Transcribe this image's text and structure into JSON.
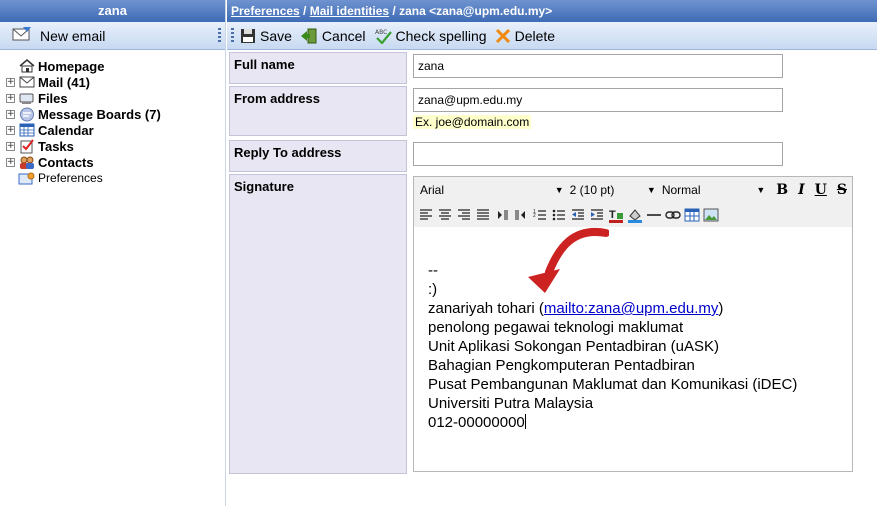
{
  "sidebar": {
    "user": "zana",
    "new_email": "New email",
    "tree": [
      {
        "label": "Homepage",
        "icon": "home-icon",
        "expandable": false
      },
      {
        "label": "Mail (41)",
        "icon": "mail-icon",
        "expandable": true
      },
      {
        "label": "Files",
        "icon": "files-icon",
        "expandable": true
      },
      {
        "label": "Message Boards (7)",
        "icon": "message-boards-icon",
        "expandable": true
      },
      {
        "label": "Calendar",
        "icon": "calendar-icon",
        "expandable": true
      },
      {
        "label": "Tasks",
        "icon": "tasks-icon",
        "expandable": true
      },
      {
        "label": "Contacts",
        "icon": "contacts-icon",
        "expandable": true
      },
      {
        "label": "Preferences",
        "icon": "preferences-icon",
        "expandable": false
      }
    ]
  },
  "breadcrumb": {
    "preferences": "Preferences",
    "sep1": " / ",
    "mail_identities": "Mail identities",
    "current": " / zana <zana@upm.edu.my>"
  },
  "toolbar": {
    "save": "Save",
    "cancel": "Cancel",
    "check_spelling": "Check spelling",
    "delete": "Delete"
  },
  "form": {
    "full_name_label": "Full name",
    "full_name_value": "zana",
    "from_address_label": "From address",
    "from_address_value": "zana@upm.edu.my",
    "from_address_hint": "Ex. joe@domain.com",
    "reply_to_label": "Reply To address",
    "reply_to_value": "",
    "signature_label": "Signature"
  },
  "editor": {
    "font": "Arial",
    "size": "2 (10 pt)",
    "style": "Normal",
    "bold": "B",
    "italic": "I",
    "underline": "U",
    "strike": "S",
    "lines": {
      "l1": "--",
      "l2": ":)",
      "l3_text": "zanariyah tohari (",
      "l3_link": "mailto:zana@upm.edu.my",
      "l3_end": ")",
      "l4": "penolong pegawai teknologi maklumat",
      "l5": "Unit Aplikasi Sokongan Pentadbiran (uASK)",
      "l6": "Bahagian Pengkomputeran Pentadbiran",
      "l7": "Pusat Pembangunan Maklumat dan Komunikasi (iDEC)",
      "l8": "Universiti Putra Malaysia",
      "l9": "012-00000000"
    }
  },
  "colors": {
    "header_blue": "#3e6bb5",
    "toolbar_blue": "#c7d9f1",
    "label_bg": "#e7e6f2",
    "hint_bg": "#ffffcc",
    "arrow_red": "#cc2222",
    "link": "#0000cc"
  }
}
